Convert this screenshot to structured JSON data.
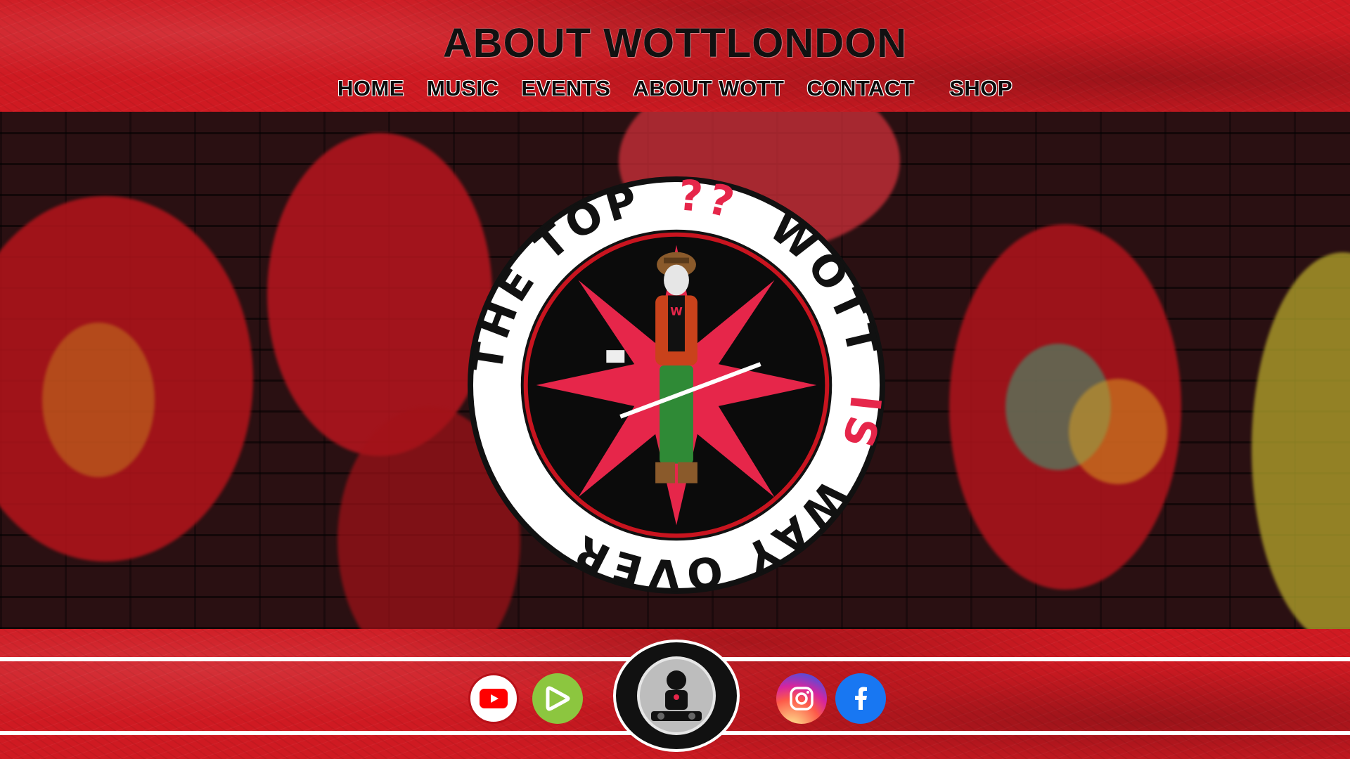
{
  "header": {
    "title": "ABOUT WOTTLONDON",
    "nav": [
      {
        "label": "HOME"
      },
      {
        "label": "MUSIC"
      },
      {
        "label": "EVENTS"
      },
      {
        "label": "ABOUT WOTT"
      },
      {
        "label": "CONTACT"
      },
      {
        "label": "SHOP"
      }
    ]
  },
  "badge": {
    "ring_text_top": "THE TOP",
    "question_marks": "??",
    "wott": "WOTT",
    "is": "IS",
    "ring_text_bottom": "WAY OVER",
    "logo_letter": "W"
  },
  "footer": {
    "social": [
      {
        "icon": "youtube-icon",
        "color": "#ff0000"
      },
      {
        "icon": "rumble-icon",
        "color": "#8cc63f"
      },
      {
        "icon": "dj-logo-icon",
        "color": "#111111"
      },
      {
        "icon": "instagram-icon",
        "color": "#d6249f"
      },
      {
        "icon": "facebook-icon",
        "color": "#1877f2"
      }
    ]
  },
  "colors": {
    "brand_red": "#cf1a22",
    "dark": "#111111",
    "accent_pink": "#e6264a"
  }
}
